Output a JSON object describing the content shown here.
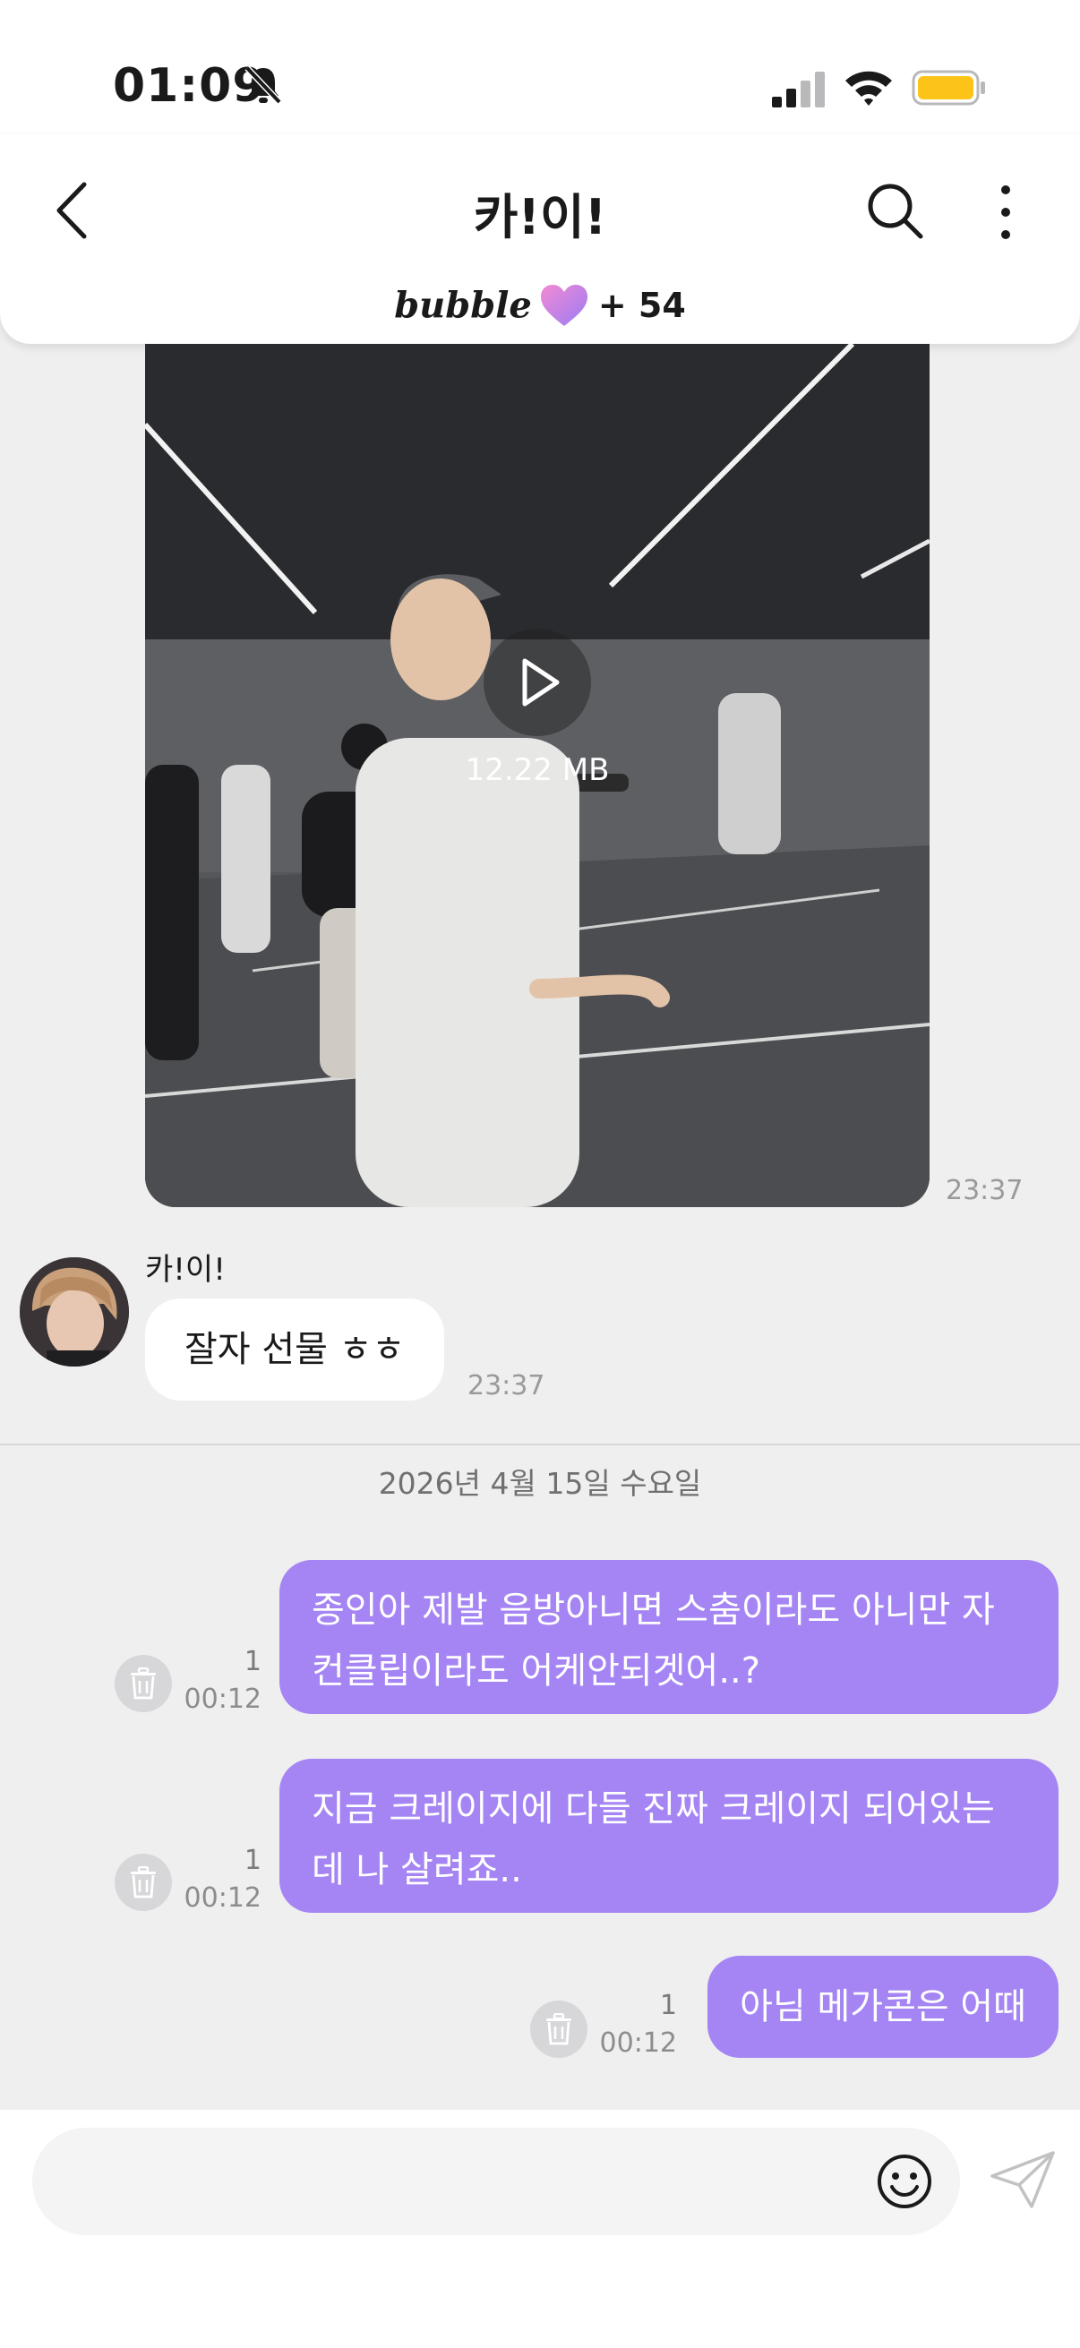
{
  "status_bar": {
    "time": "01:09"
  },
  "header": {
    "title": "카!이!",
    "bubble_brand": "bubble",
    "bubble_count": "+ 54"
  },
  "messages": {
    "video": {
      "size": "12.22 MB",
      "time": "23:37"
    },
    "incoming": {
      "sender": "카!이!",
      "text": "잘자 선물 ㅎㅎ",
      "time": "23:37"
    },
    "date_divider": "2026년 4월 15일 수요일",
    "outgoing": [
      {
        "text": "종인아 제발 음방아니면 스춤이라도 아니만 자컨클립이라도 어케안되겟어..?",
        "read": "1",
        "time": "00:12"
      },
      {
        "text": "지금 크레이지에 다들 진짜 크레이지 되어있는데 나 살려죠..",
        "read": "1",
        "time": "00:12"
      },
      {
        "text": "아님 메가콘은 어때",
        "read": "1",
        "time": "00:12"
      }
    ]
  },
  "composer": {
    "placeholder": ""
  },
  "colors": {
    "outgoing_bubble": "#a585f3",
    "battery": "#fcc419",
    "background": "#efeff0"
  }
}
